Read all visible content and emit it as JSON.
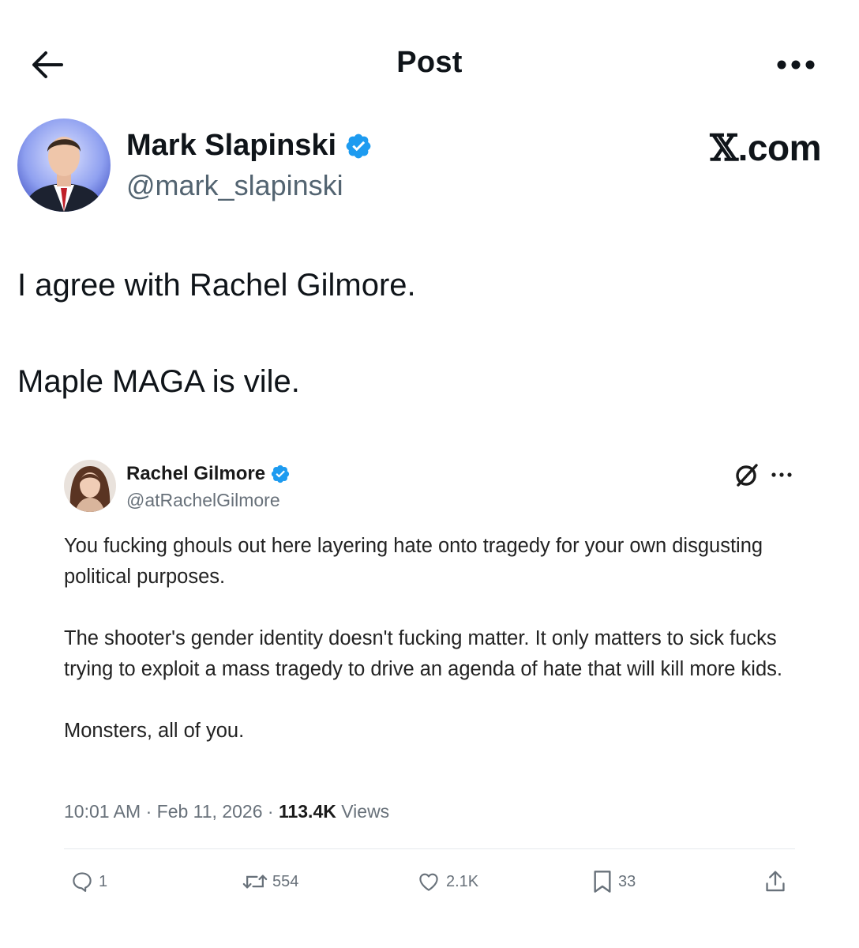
{
  "header": {
    "title": "Post",
    "back_icon": "arrow-left-icon",
    "more_icon": "more-horizontal-icon"
  },
  "author": {
    "name": "Mark Slapinski",
    "handle": "@mark_slapinski",
    "verified": true,
    "verified_color": "#1d9bf0"
  },
  "source_label": {
    "x": "𝕏",
    "rest": ".com"
  },
  "post": {
    "paragraphs": [
      "I agree with Rachel Gilmore.",
      "Maple MAGA is vile."
    ]
  },
  "quoted": {
    "name": "Rachel Gilmore",
    "handle": "@atRachelGilmore",
    "verified": true,
    "paragraphs": [
      "You fucking ghouls out here layering hate onto tragedy for your own disgusting political purposes.",
      "The shooter's gender identity doesn't fucking matter. It only matters to sick fucks trying to exploit a mass tragedy to drive an agenda of hate that will kill more kids.",
      "Monsters, all of you."
    ],
    "time": "10:01 AM",
    "date": "Feb 11, 2026",
    "sep": "·",
    "views_count": "113.4K",
    "views_label": "Views",
    "actions": {
      "reply": "1",
      "repost": "554",
      "like": "2.1K",
      "bookmark": "33"
    }
  }
}
